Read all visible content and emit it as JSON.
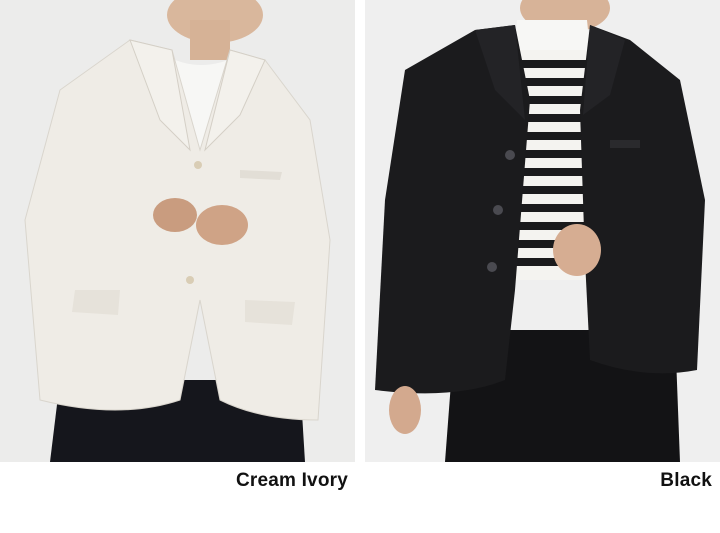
{
  "variants": [
    {
      "label": "Cream Ivory",
      "jacket_color": "#efece6",
      "background_color": "#ececeb"
    },
    {
      "label": "Black",
      "jacket_color": "#1b1b1d",
      "background_color": "#efefef"
    }
  ]
}
